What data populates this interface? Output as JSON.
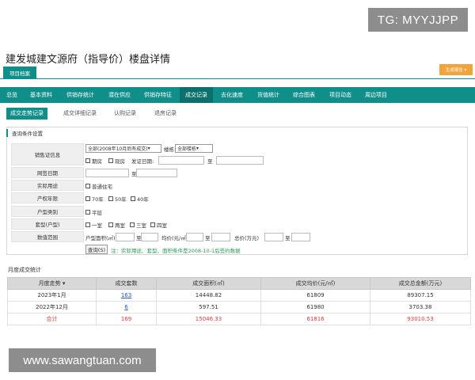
{
  "watermarks": {
    "top": "TG: MYYJJPP",
    "bottom": "www.sawangtuan.com"
  },
  "page_title": "建发城建文源府（指导价）楼盘详情",
  "top_tab": "项目档案",
  "report_button": "生成报告 ▾",
  "mainnav": [
    "总览",
    "基本资料",
    "供销存统计",
    "潜在供应",
    "供销存特征",
    "成交记录",
    "去化速度",
    "货值统计",
    "综合图表",
    "项目动态",
    "周边项目"
  ],
  "mainnav_active": "成交记录",
  "subtabs": [
    "成交走势记录",
    "成交详细记录",
    "认购记录",
    "退房记录"
  ],
  "query": {
    "title": "查询条件设置",
    "labels": [
      "销售证信息",
      "网签日期",
      "实际用途",
      "产权年限",
      "户型类别",
      "套型(户型)",
      "数值范围"
    ],
    "sales_period": "全部(2008年10月后有成交)",
    "building_label": "楼栋:",
    "building_value": "全部楼栋",
    "issue_date_label": "发证日期:",
    "to": "至",
    "options": {
      "sales_type": [
        "期房",
        "现房"
      ],
      "usage": [
        "普通住宅"
      ],
      "years": [
        "70年",
        "50年",
        "40年"
      ],
      "unit_class": [
        "平层"
      ],
      "unit_type": [
        "一室",
        "两室",
        "三室",
        "四室"
      ]
    },
    "range": {
      "area": "户型面积(㎡)",
      "unit_price": "均价(元/㎡)",
      "total_price": "总价(万元)"
    },
    "query_button": "查询(S)",
    "note": "注：实际用途、套型、面积条件是2008-10-1后签约数据"
  },
  "stats": {
    "title": "月度成交统计",
    "columns": [
      "月度走势 ▾",
      "成交套数",
      "成交面积(㎡)",
      "成交均价(元/㎡)",
      "成交总金额(万元)"
    ],
    "rows": [
      {
        "month": "2023年1月",
        "count": "163",
        "area": "14448.82",
        "avg": "61809",
        "total": "89307.15"
      },
      {
        "month": "2022年12月",
        "count": "6",
        "area": "597.51",
        "avg": "61980",
        "total": "3703.38"
      }
    ],
    "total_row": {
      "month": "合计",
      "count": "169",
      "area": "15046.33",
      "avg": "61816",
      "total": "93010.53"
    }
  }
}
